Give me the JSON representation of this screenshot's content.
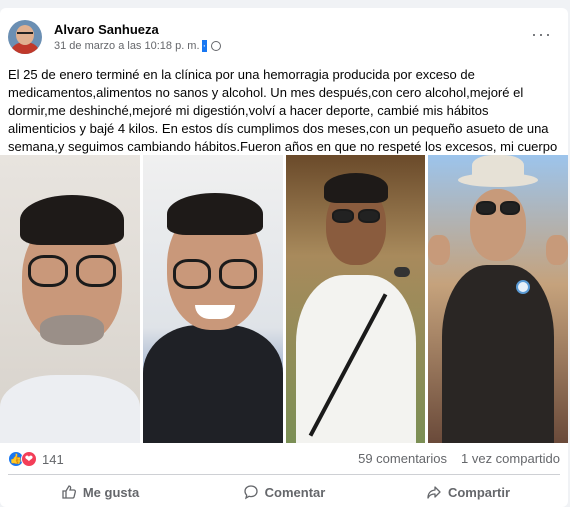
{
  "post": {
    "author": "Alvaro Sanhueza",
    "timestamp": "31 de marzo a las 10:18 p. m.",
    "timestamp_highlight": "·",
    "privacy_icon": "globe-icon",
    "more_icon": "···",
    "text": "El 25 de enero terminé en la clínica por una hemorragia producida por exceso de medicamentos,alimentos no sanos y alcohol. Un mes después,con cero alcohol,mejoré el dormir,me deshinché,mejoré mi digestión,volví a hacer deporte, cambié mis hábitos alimenticios y bajé 4 kilos. En estos dís cumplimos dos meses,con un pequeño asueto de una semana,y seguimos cambiando hábitos.Fueron años en que no respeté los excesos, mi cuerpo y mi Salud."
  },
  "stats": {
    "reaction_like_icon": "👍",
    "reaction_love_icon": "❤",
    "reaction_count": "141",
    "comments": "59 comentarios",
    "shares": "1 vez compartido"
  },
  "actions": {
    "like_label": "Me gusta",
    "comment_label": "Comentar",
    "share_label": "Compartir"
  },
  "colors": {
    "accent": "#1877f2",
    "love": "#f33e58",
    "secondary_text": "#65676b"
  }
}
